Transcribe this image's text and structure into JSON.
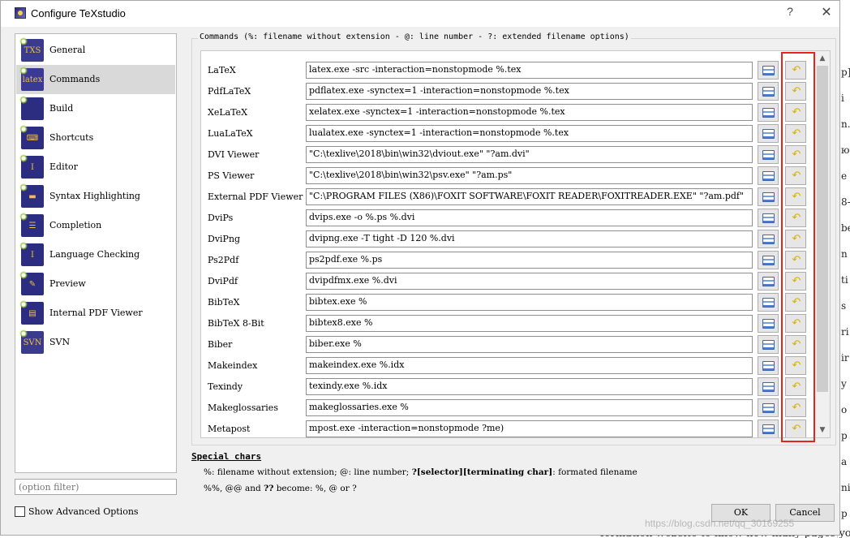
{
  "window": {
    "title": "Configure TeXstudio",
    "help_glyph": "?",
    "close_glyph": "✕"
  },
  "sidebar": {
    "items": [
      {
        "label": "General",
        "icon": "txs-icon",
        "glyph": "TXS",
        "color": "#3b3b8e"
      },
      {
        "label": "Commands",
        "icon": "latex-icon",
        "glyph": "latex",
        "color": "#3a3a96"
      },
      {
        "label": "Build",
        "icon": "build-icon",
        "glyph": "",
        "color": "#2c2c80"
      },
      {
        "label": "Shortcuts",
        "icon": "keyboard-icon",
        "glyph": "⌨",
        "color": "#2c2c80"
      },
      {
        "label": "Editor",
        "icon": "editor-icon",
        "glyph": "I",
        "color": "#2c2c80"
      },
      {
        "label": "Syntax Highlighting",
        "icon": "syntax-highlight-icon",
        "glyph": "▬",
        "color": "#2c2c80"
      },
      {
        "label": "Completion",
        "icon": "completion-icon",
        "glyph": "☰",
        "color": "#2c2c80"
      },
      {
        "label": "Language Checking",
        "icon": "language-check-icon",
        "glyph": "I",
        "color": "#2c2c80"
      },
      {
        "label": "Preview",
        "icon": "preview-icon",
        "glyph": "✎",
        "color": "#2c2c80"
      },
      {
        "label": "Internal PDF Viewer",
        "icon": "pdf-viewer-icon",
        "glyph": "▤",
        "color": "#2c2c80"
      },
      {
        "label": "SVN",
        "icon": "svn-icon",
        "glyph": "SVN",
        "color": "#3b3b8e"
      }
    ],
    "selected_index": 1,
    "filter_placeholder": "(option filter)",
    "advanced_label": "Show Advanced Options"
  },
  "commands": {
    "group_title": "Commands (%: filename without extension - @: line number - ?: extended filename options)",
    "rows": [
      {
        "label": "LaTeX",
        "value": "latex.exe -src -interaction=nonstopmode %.tex"
      },
      {
        "label": "PdfLaTeX",
        "value": "pdflatex.exe -synctex=1 -interaction=nonstopmode %.tex"
      },
      {
        "label": "XeLaTeX",
        "value": "xelatex.exe -synctex=1 -interaction=nonstopmode %.tex"
      },
      {
        "label": "LuaLaTeX",
        "value": "lualatex.exe -synctex=1 -interaction=nonstopmode %.tex"
      },
      {
        "label": "DVI Viewer",
        "value": "\"C:\\texlive\\2018\\bin\\win32\\dviout.exe\" \"?am.dvi\""
      },
      {
        "label": "PS Viewer",
        "value": "\"C:\\texlive\\2018\\bin\\win32\\psv.exe\" \"?am.ps\""
      },
      {
        "label": "External PDF Viewer",
        "value": "\"C:\\PROGRAM FILES (X86)\\FOXIT SOFTWARE\\FOXIT READER\\FOXITREADER.EXE\" \"?am.pdf\""
      },
      {
        "label": "DviPs",
        "value": "dvips.exe -o %.ps %.dvi"
      },
      {
        "label": "DviPng",
        "value": "dvipng.exe -T tight -D 120 %.dvi"
      },
      {
        "label": "Ps2Pdf",
        "value": "ps2pdf.exe %.ps"
      },
      {
        "label": "DviPdf",
        "value": "dvipdfmx.exe %.dvi"
      },
      {
        "label": "BibTeX",
        "value": "bibtex.exe %"
      },
      {
        "label": "BibTeX 8-Bit",
        "value": "bibtex8.exe %"
      },
      {
        "label": "Biber",
        "value": "biber.exe %"
      },
      {
        "label": "Makeindex",
        "value": "makeindex.exe %.idx"
      },
      {
        "label": "Texindy",
        "value": "texindy.exe %.idx"
      },
      {
        "label": "Makeglossaries",
        "value": "makeglossaries.exe %"
      },
      {
        "label": "Metapost",
        "value": "mpost.exe -interaction=nonstopmode ?me)"
      }
    ],
    "browse_icon": "save-disk-icon",
    "reset_icon": "undo-arrow-icon",
    "reset_glyph": "↶",
    "scroll_up": "▲",
    "scroll_down": "▼",
    "highlight_color": "#e8231d"
  },
  "special": {
    "title": "Special chars",
    "line1_a": "%: filename without extension; @: line number; ",
    "line1_b": "?[selector][terminating char]",
    "line1_c": ": formated filename",
    "line2_a": "%%, @@ and ",
    "line2_b": "??",
    "line2_c": " become: %, @ or ?"
  },
  "buttons": {
    "ok": "OK",
    "cancel": "Cancel"
  },
  "background": {
    "right_fragments": [
      "p]",
      "i",
      "n.",
      "ю",
      "e",
      "8-",
      "be",
      "n",
      "ti",
      "s",
      "ri",
      "ir",
      "y",
      "o",
      "p",
      "a",
      "ni",
      "p"
    ],
    "bottom_text": "formation website to know how many pages yo",
    "watermark": "https://blog.csdn.net/qq_30169255"
  }
}
